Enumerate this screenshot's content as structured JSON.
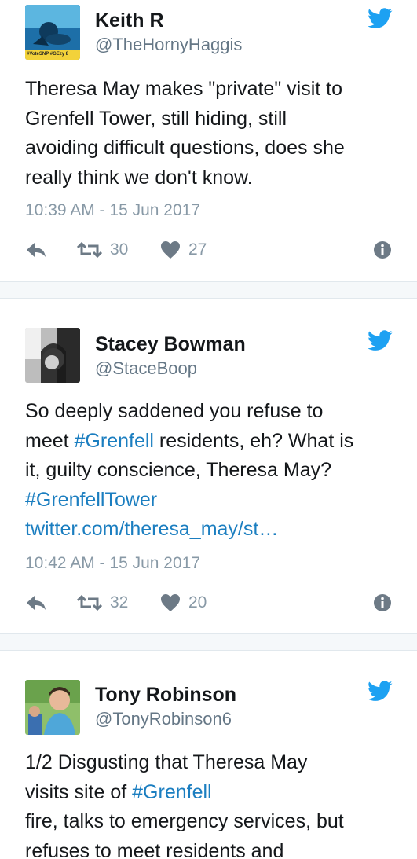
{
  "tweets": [
    {
      "name": "Keith R",
      "handle": "@TheHornyHaggis",
      "avatar_badge": "#VoteSNP #GEzy 8",
      "lines": [
        [
          {
            "t": "Theresa May makes \"private\" visit to"
          }
        ],
        [
          {
            "t": "Grenfell Tower, still hiding, still"
          }
        ],
        [
          {
            "t": "avoiding difficult questions, does she"
          }
        ],
        [
          {
            "t": "really think we don't know."
          }
        ]
      ],
      "timestamp": "10:39 AM - 15 Jun 2017",
      "retweets": "30",
      "likes": "27"
    },
    {
      "name": "Stacey Bowman",
      "handle": "@StaceBoop",
      "lines": [
        [
          {
            "t": "So deeply saddened you refuse to"
          }
        ],
        [
          {
            "t": "meet "
          },
          {
            "t": "#Grenfell",
            "link": true
          },
          {
            "t": " residents, eh? What is"
          }
        ],
        [
          {
            "t": "it, guilty conscience, Theresa May?"
          }
        ],
        [
          {
            "t": "#GrenfellTower",
            "link": true
          }
        ],
        [
          {
            "t": "twitter.com/theresa_may/st…",
            "link": true
          }
        ]
      ],
      "timestamp": "10:42 AM - 15 Jun 2017",
      "retweets": "32",
      "likes": "20"
    },
    {
      "name": "Tony Robinson",
      "handle": "@TonyRobinson6",
      "lines": [
        [
          {
            "t": "1/2 Disgusting that Theresa May"
          }
        ],
        [
          {
            "t": "visits site of "
          },
          {
            "t": "#Grenfell",
            "link": true
          }
        ],
        [
          {
            "t": "fire, talks to emergency services, but"
          }
        ],
        [
          {
            "t": "refuses to meet residents and"
          }
        ]
      ]
    }
  ],
  "icons": {
    "bird": "twitter-bird-icon",
    "reply": "reply-icon",
    "retweet": "retweet-icon",
    "like": "heart-icon",
    "info": "info-icon"
  },
  "colors": {
    "twitter_blue": "#1da1f2",
    "link": "#1b7ec0",
    "secondary_text": "#657786",
    "icon_gray": "#8899a6",
    "separator": "#f5f8fa"
  }
}
